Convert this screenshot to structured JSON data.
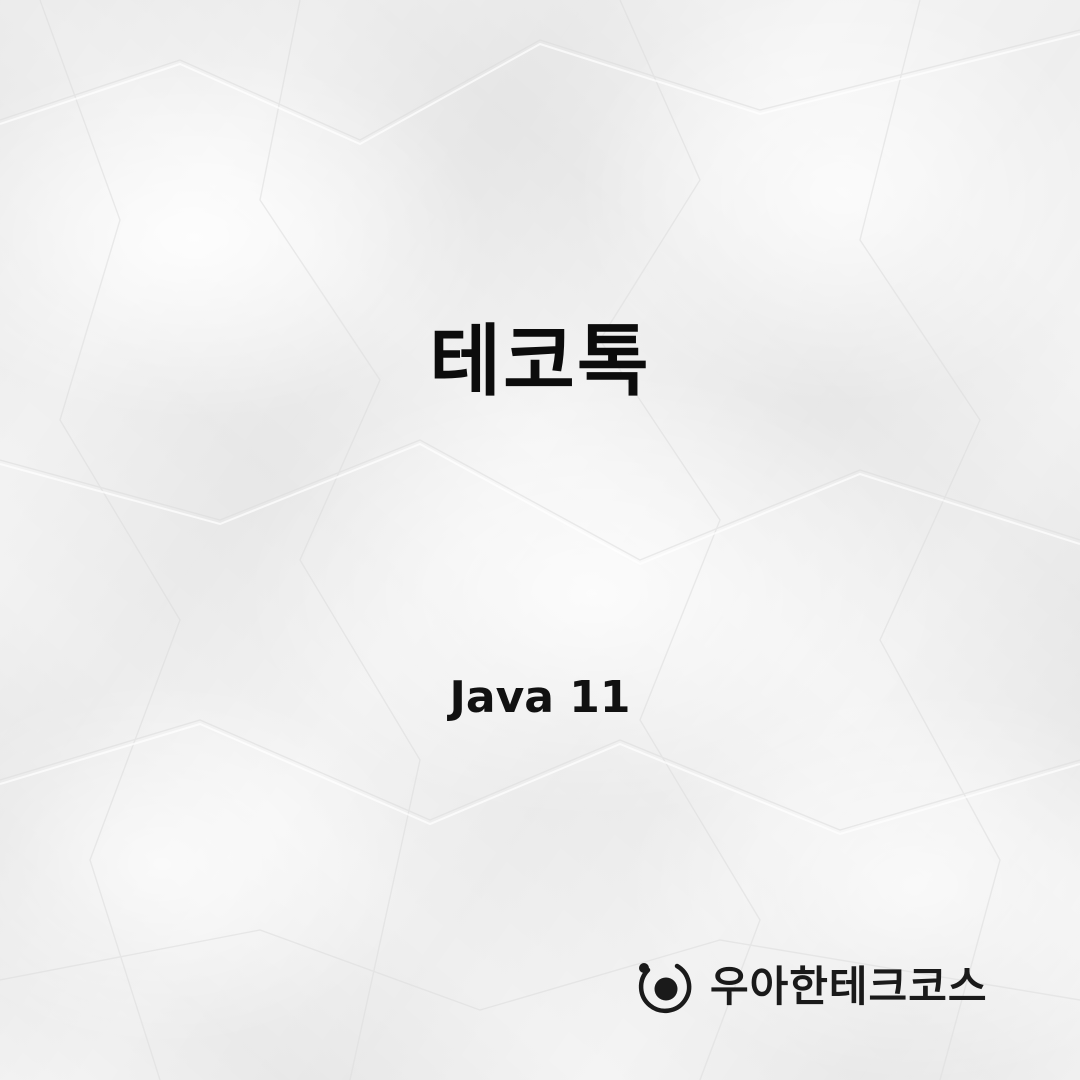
{
  "title": "테코톡",
  "subtitle": "Java 11",
  "brand": {
    "icon": "woowa-orbit-icon",
    "name": "우아한테크코스"
  },
  "colors": {
    "background": "#f4f4f4",
    "text": "#0c0c0c"
  }
}
